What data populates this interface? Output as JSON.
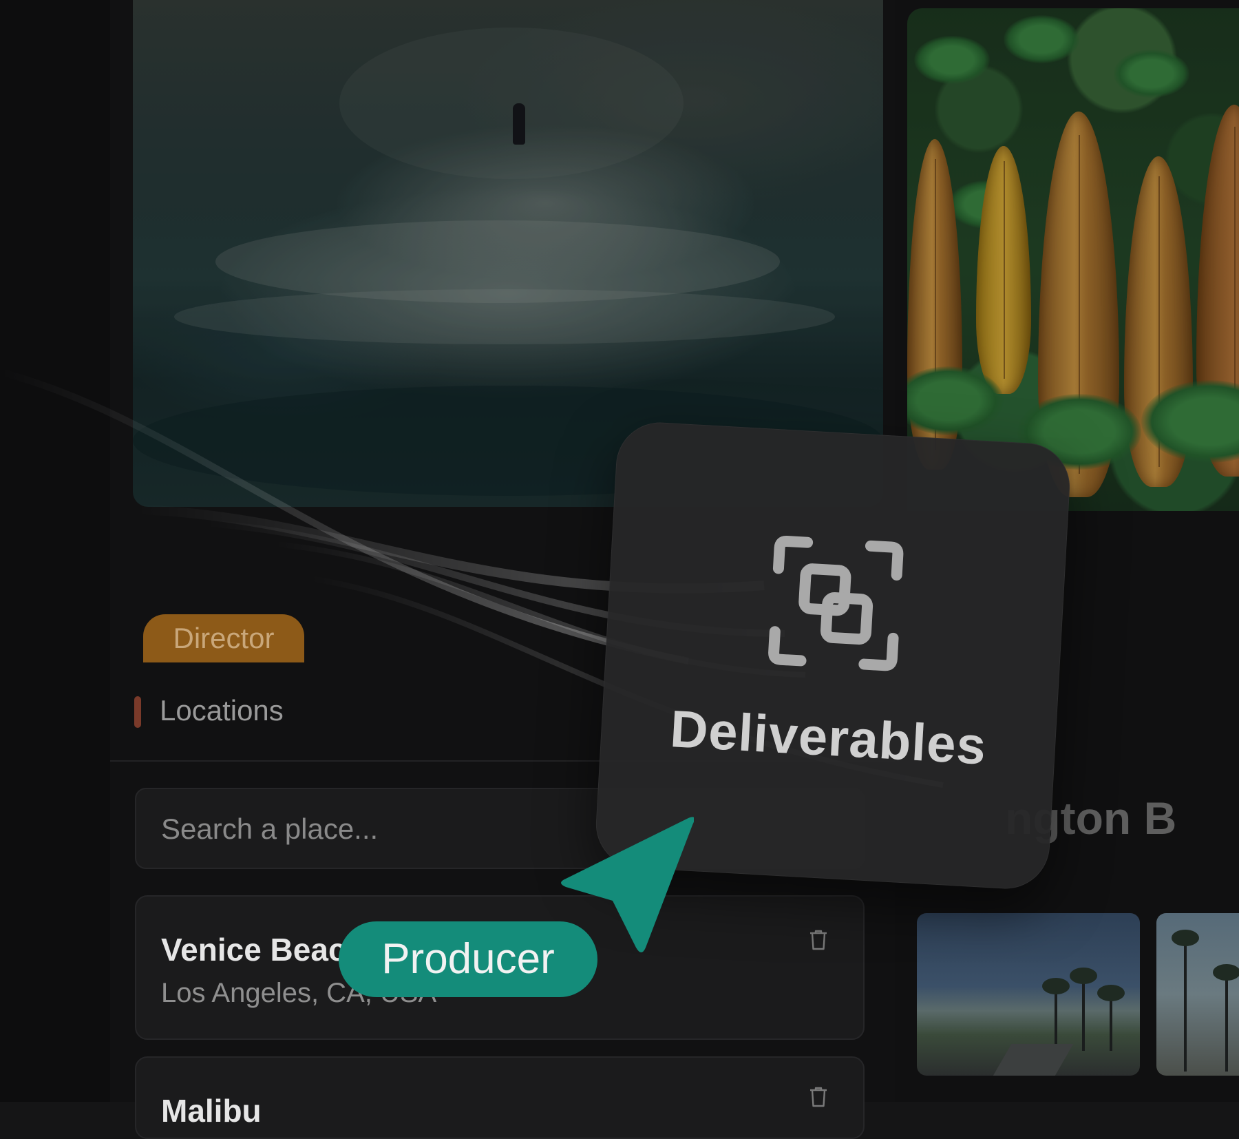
{
  "hero": {
    "left_photo": "surfer-in-ocean-waves",
    "right_photo": "surfboards-among-plants"
  },
  "tags": {
    "director": "Director",
    "producer": "Producer"
  },
  "sidebar_section": {
    "label": "Locations",
    "marker_color": "#7a3a2a"
  },
  "search": {
    "placeholder": "Search a place..."
  },
  "locations": [
    {
      "name": "Venice Beach",
      "subtitle": "Los Angeles, CA, USA"
    },
    {
      "name": "Malibu",
      "subtitle": ""
    }
  ],
  "detail": {
    "title_fragment": "ngton B"
  },
  "floating_card": {
    "label": "Deliverables",
    "icon": "bounding-box-icon"
  },
  "colors": {
    "director_tag": "#8d5a18",
    "producer_tag": "#148c7a",
    "cursor": "#148c7a"
  }
}
